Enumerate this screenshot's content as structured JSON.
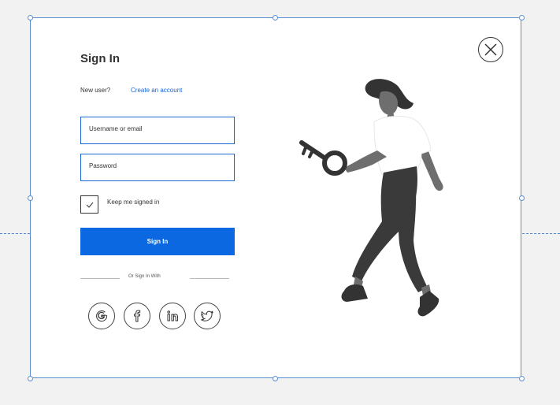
{
  "form": {
    "title": "Sign In",
    "new_user_text": "New user?",
    "create_account_link": "Create an account",
    "username_placeholder": "Username or email",
    "password_placeholder": "Password",
    "keep_signed_in_label": "Keep me signed in",
    "keep_signed_in_checked": true,
    "signin_button_label": "Sign In",
    "or_sign_in_with": "Or Sign In With"
  },
  "social": [
    {
      "icon": "google-icon"
    },
    {
      "icon": "facebook-icon"
    },
    {
      "icon": "linkedin-icon"
    },
    {
      "icon": "twitter-icon"
    }
  ],
  "colors": {
    "accent": "#0b68e0",
    "selection": "#5a8fd1",
    "figure_dark": "#3a3a3a",
    "figure_mid": "#6b6b6b"
  }
}
